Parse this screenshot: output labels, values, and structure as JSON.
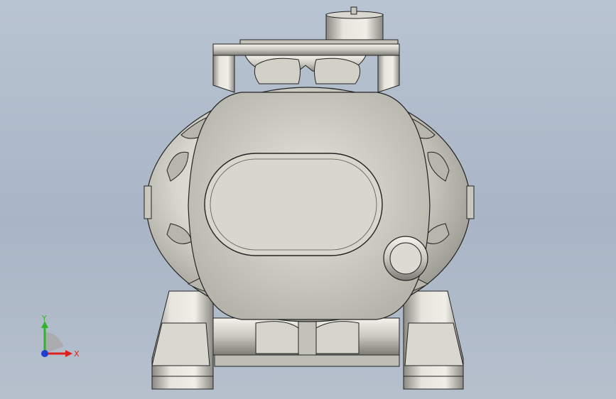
{
  "viewport": {
    "background_top": "#b9c4d2",
    "background_bottom": "#b6c0cd"
  },
  "model": {
    "name_icon": "pump-housing-3d-model",
    "body_color": "#d6d5cc",
    "edge_color": "#1e1e1e"
  },
  "triad": {
    "x_label": "X",
    "y_label": "Y",
    "x_color": "#e0201c",
    "y_color": "#2fb52b",
    "z_color": "#1f3fd0"
  }
}
